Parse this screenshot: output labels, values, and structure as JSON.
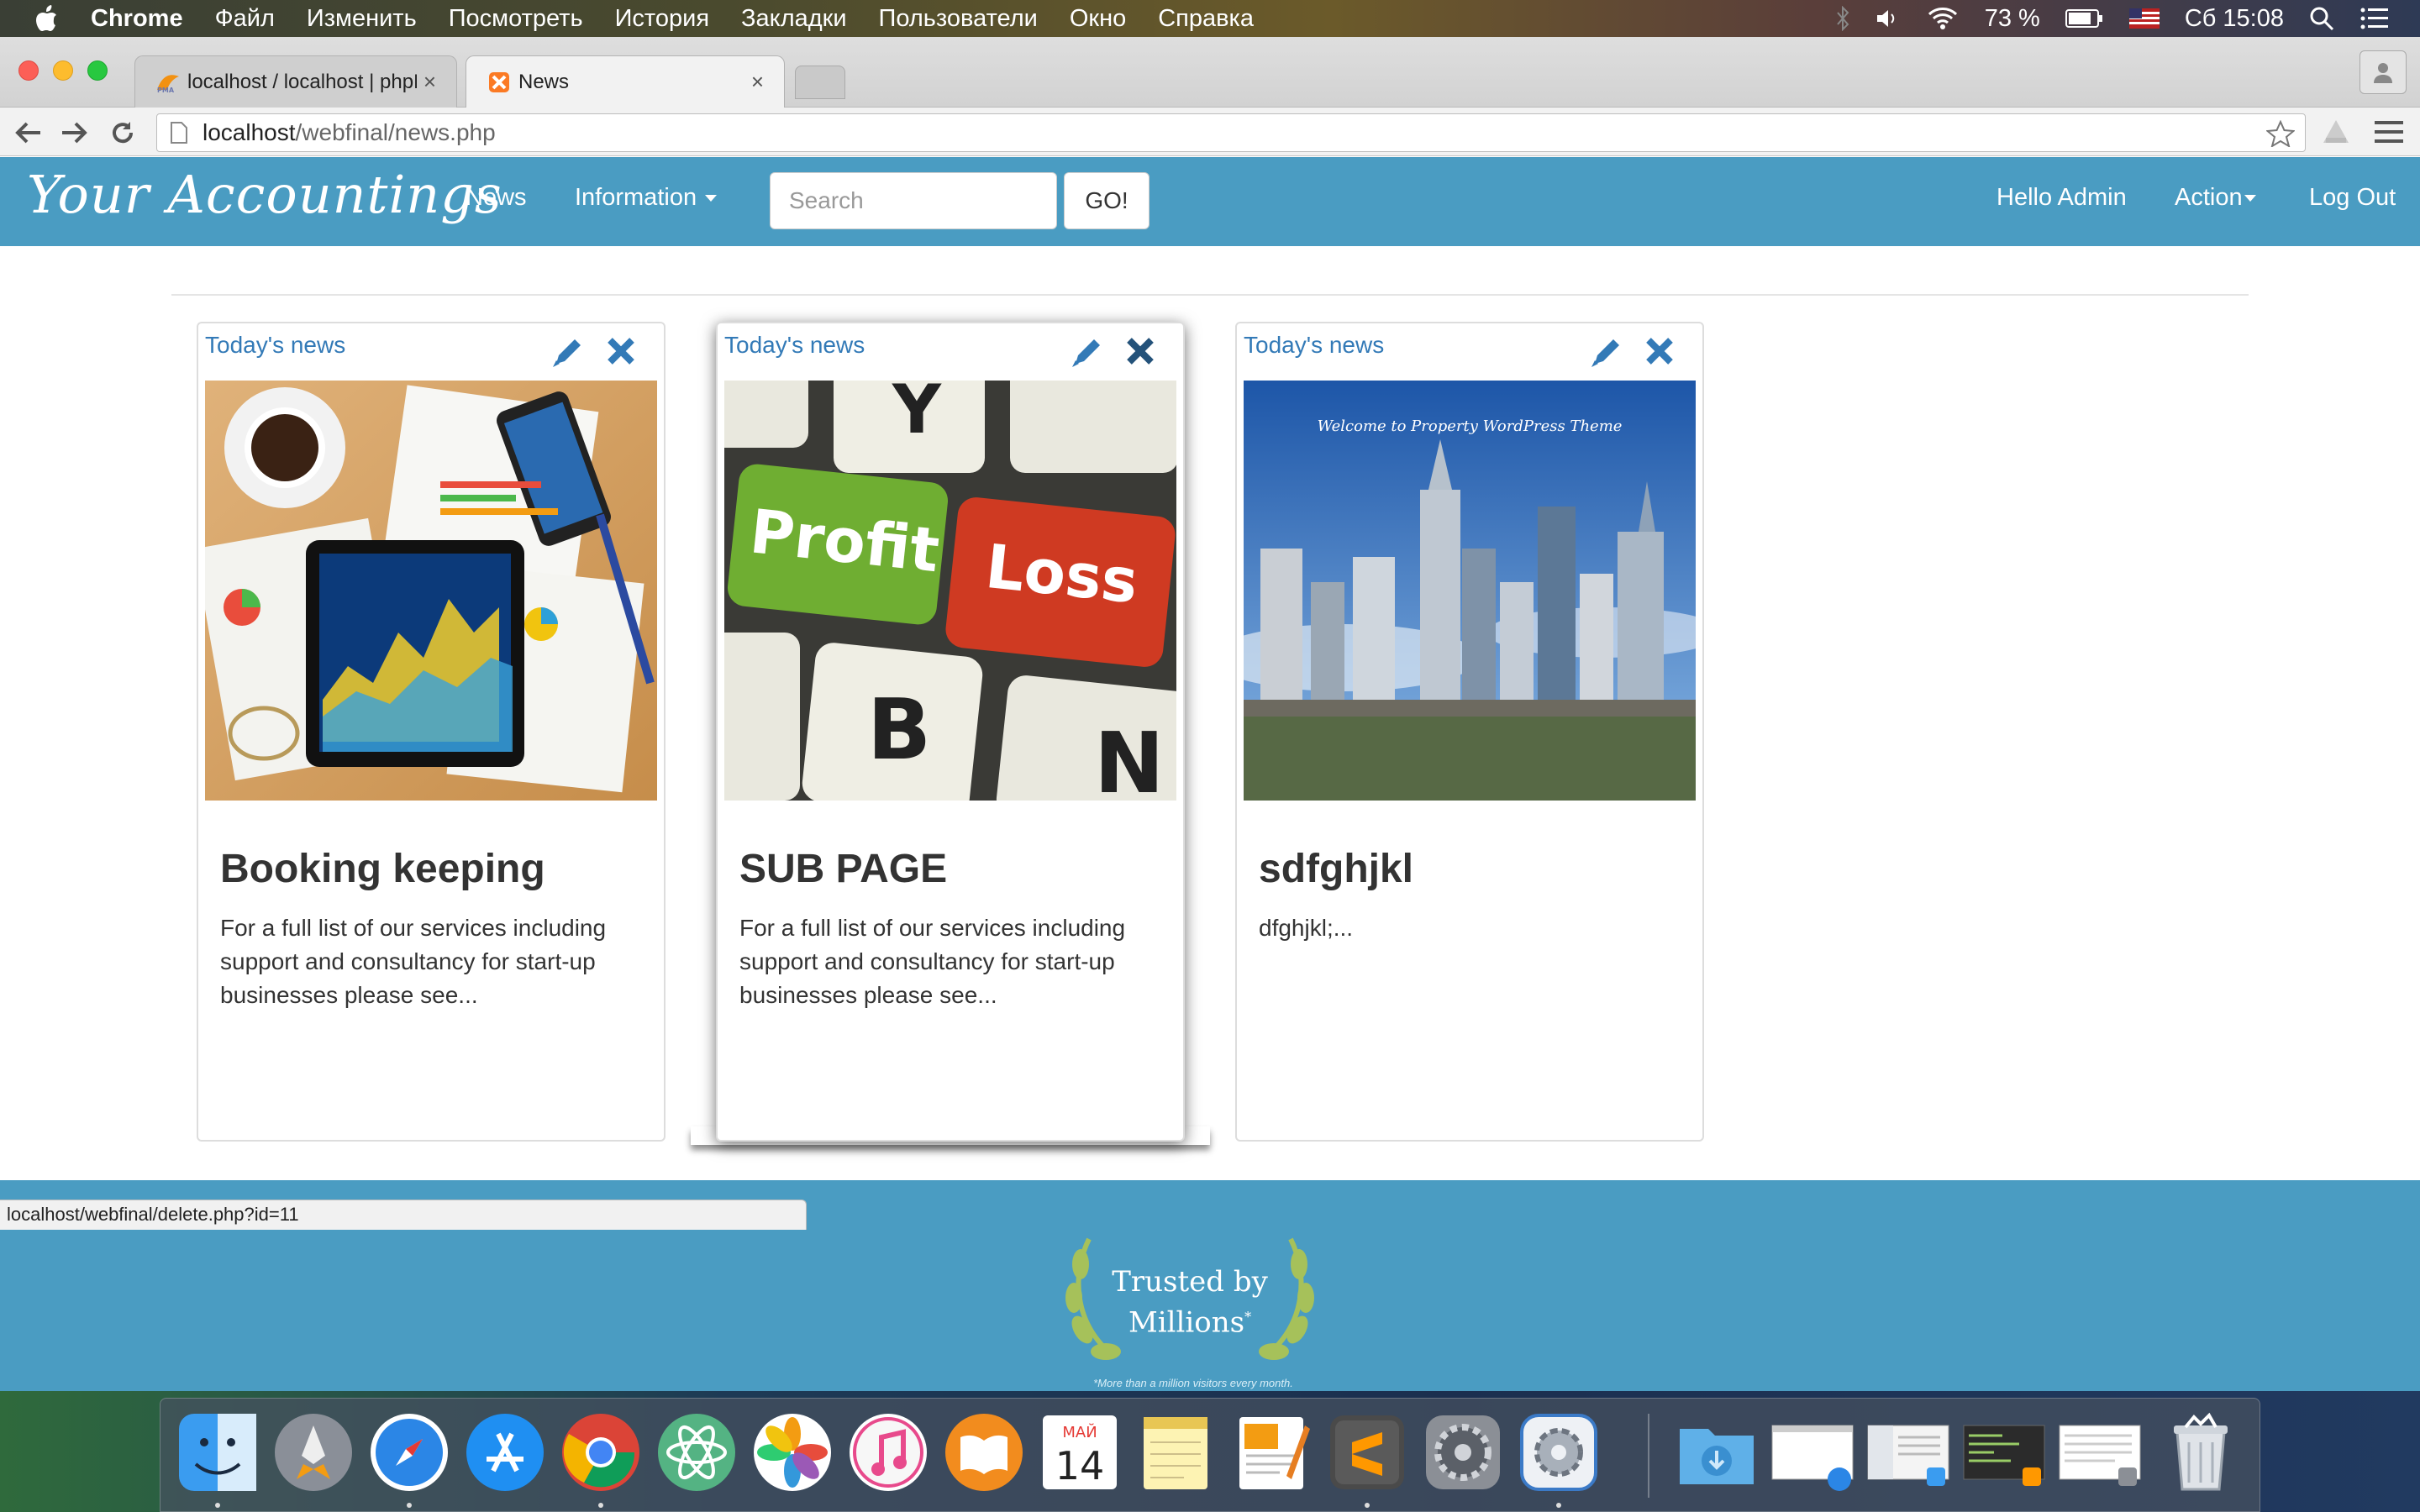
{
  "menubar": {
    "app_name": "Chrome",
    "menus": [
      "Файл",
      "Изменить",
      "Посмотреть",
      "История",
      "Закладки",
      "Пользователи",
      "Окно",
      "Справка"
    ],
    "battery": "73 %",
    "clock": "Сб 15:08"
  },
  "browser": {
    "tabs": [
      {
        "title": "localhost / localhost | phpMyAdmin",
        "icon": "phpmyadmin-icon"
      },
      {
        "title": "News",
        "icon": "xampp-icon"
      }
    ],
    "url_host": "localhost",
    "url_path": "/webfinal/news.php",
    "status_url": "localhost/webfinal/delete.php?id=11"
  },
  "site": {
    "brand": "Your Accountings",
    "nav": {
      "news": "News",
      "information": "Information",
      "greeting": "Hello Admin",
      "action": "Action",
      "logout": "Log Out"
    },
    "search": {
      "placeholder": "Search",
      "button": "GO!"
    },
    "cards": [
      {
        "kicker": "Today's news",
        "title": "Booking keeping",
        "summary": "For a full list of our services including support and consultancy for start-up businesses please see...",
        "image": "finance-desk-tablet-image"
      },
      {
        "kicker": "Today's news",
        "title": "SUB PAGE",
        "summary": "For a full list of our services including support and consultancy for start-up businesses please see...",
        "image": "profit-loss-keyboard-image",
        "key_labels": [
          "Profit",
          "Loss",
          "Y",
          "B",
          "N"
        ]
      },
      {
        "kicker": "Today's news",
        "title": "sdfghjkl",
        "summary": "dfghjkl;...",
        "image": "city-skyline-image",
        "image_caption": "Welcome to Property WordPress Theme"
      }
    ],
    "footer": {
      "badge_line1": "Trusted by",
      "badge_line2": "Millions",
      "badge_mark": "*",
      "note": "*More than a million visitors every month."
    }
  },
  "dock": {
    "calendar_month": "МАЙ",
    "calendar_day": "14",
    "items": [
      "finder-icon",
      "launchpad-icon",
      "safari-icon",
      "app-store-icon",
      "chrome-icon",
      "atom-icon",
      "photos-icon",
      "itunes-icon",
      "ibooks-icon",
      "calendar-icon",
      "notes-icon",
      "pages-icon",
      "sublime-text-icon",
      "system-preferences-icon",
      "xampp-manager-icon",
      "downloads-folder-icon",
      "window-thumbnail-icon",
      "trash-icon"
    ]
  },
  "colors": {
    "nav_bg": "#4a9cc2",
    "link": "#337ab7",
    "footer_bg": "#4a9cc2"
  }
}
